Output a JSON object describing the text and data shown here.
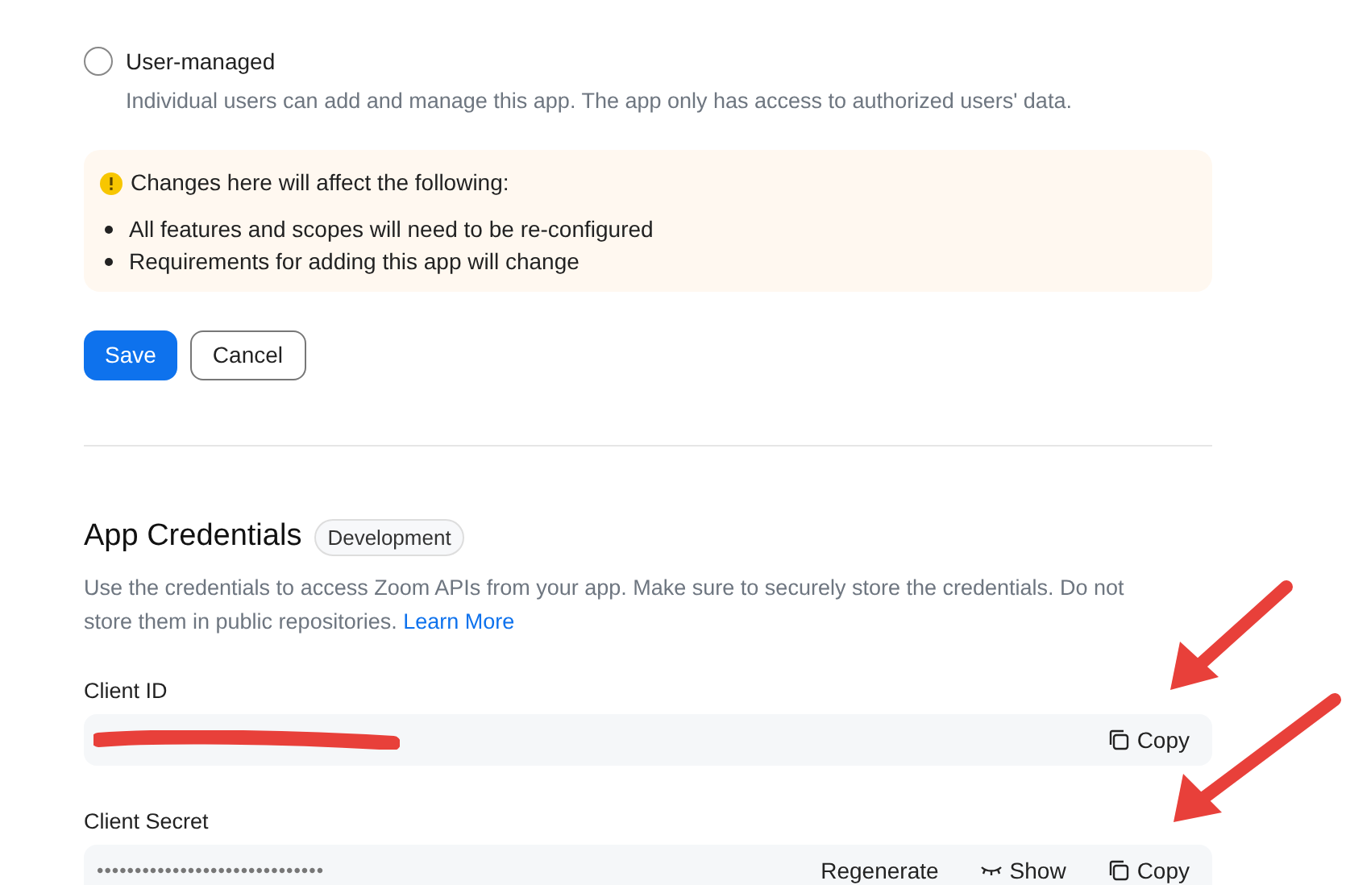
{
  "access_options": [
    {
      "label": "User-managed",
      "description": "Individual users can add and manage this app. The app only has access to authorized users' data.",
      "selected": false
    }
  ],
  "warning": {
    "title": "Changes here will affect the following:",
    "items": [
      "All features and scopes will need to be re-configured",
      "Requirements for adding this app will change"
    ]
  },
  "actions": [
    {
      "label": "Save",
      "kind": "primary"
    },
    {
      "label": "Cancel",
      "kind": "secondary"
    }
  ],
  "credentials": {
    "title": "App Credentials",
    "badge": "Development",
    "description": "Use the credentials to access Zoom APIs from your app. Make sure to securely store the credentials. Do not store them in public repositories.",
    "link": "Learn More",
    "fields": [
      {
        "label": "Client ID",
        "redacted": true,
        "buttons": [
          {
            "kind": "copy",
            "label": "Copy"
          }
        ]
      },
      {
        "label": "Client Secret",
        "value": "••••••••••••••••••••••••••••••",
        "redacted": false,
        "buttons": [
          {
            "kind": "text",
            "label": "Regenerate"
          },
          {
            "kind": "show",
            "label": "Show"
          },
          {
            "kind": "copy",
            "label": "Copy"
          }
        ]
      }
    ]
  }
}
